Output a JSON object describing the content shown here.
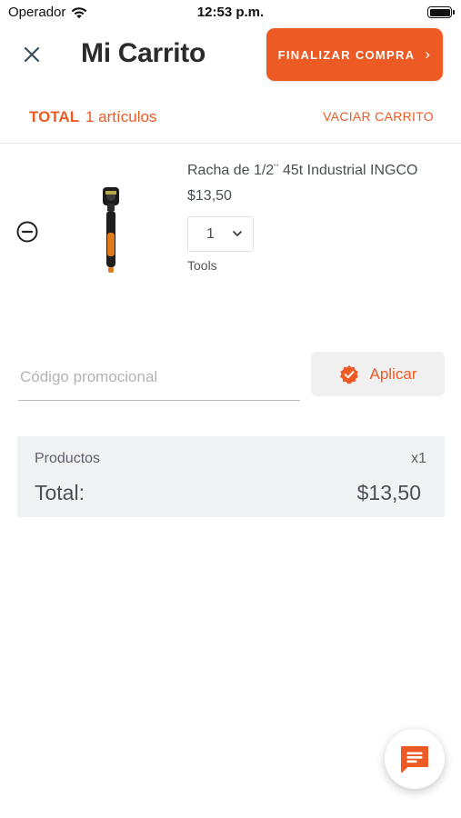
{
  "status_bar": {
    "carrier": "Operador",
    "time": "12:53 p.m.",
    "battery_level": 1.0
  },
  "header": {
    "title": "Mi Carrito",
    "checkout_label": "FINALIZAR COMPRA",
    "close_icon": "close-icon",
    "accent_color": "#ee5a24"
  },
  "summary": {
    "total_label": "TOTAL",
    "items_count": "1 artículos",
    "empty_cart_label": "VACIAR CARRITO"
  },
  "cart": {
    "items": [
      {
        "name": "Racha de 1/2¨ 45t Industrial INGCO",
        "price": "$13,50",
        "quantity": "1",
        "category": "Tools"
      }
    ]
  },
  "promo": {
    "placeholder": "Código promocional",
    "apply_label": "Aplicar"
  },
  "totals": {
    "products_label": "Productos",
    "products_qty": "x1",
    "total_label": "Total:",
    "total_amount": "$13,50"
  }
}
